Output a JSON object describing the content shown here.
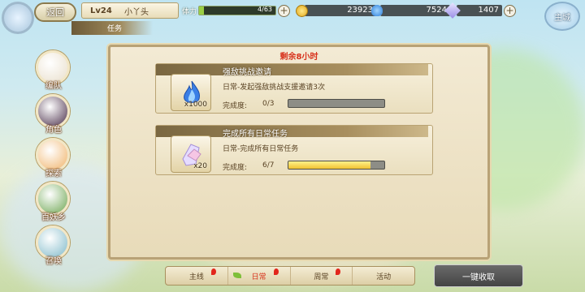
{
  "header": {
    "back_label": "返回",
    "level": "Lv24",
    "player_name": "小丫头",
    "task_tab": "任务",
    "stamina_label": "体力",
    "stamina_value": "4/63",
    "stamina_fraction": 0.06,
    "gold": "23923",
    "gems": "7524",
    "crystals": "1407",
    "main_label": "主城"
  },
  "sidebar": [
    {
      "label": "编队",
      "color": "#e9dfcc",
      "icon": "squad-icon"
    },
    {
      "label": "角色",
      "color": "#4a2f4a",
      "icon": "character-icon"
    },
    {
      "label": "探索",
      "color": "#f0b36a",
      "icon": "explore-icon"
    },
    {
      "label": "百妖乡",
      "color": "#6da652",
      "icon": "village-icon"
    },
    {
      "label": "召唤",
      "color": "#7fb9c9",
      "icon": "summon-icon"
    }
  ],
  "panel": {
    "remaining": "剩余8小时",
    "quests": [
      {
        "title": "强敌挑战邀请",
        "description": "日常-发起强敌挑战支援邀请3次",
        "progress_label": "完成度:",
        "progress_text": "0/3",
        "progress": 0,
        "reward_count": "x1000",
        "reward_icon": "blue-flame-icon"
      },
      {
        "title": "完成所有日常任务",
        "description": "日常-完成所有日常任务",
        "progress_label": "完成度:",
        "progress_text": "6/7",
        "progress": 0.857,
        "reward_count": "x20",
        "reward_icon": "crystal-shard-icon"
      }
    ]
  },
  "tabs": [
    {
      "label": "主线",
      "alert": true
    },
    {
      "label": "日常",
      "alert": true,
      "active": true
    },
    {
      "label": "周常",
      "alert": true
    },
    {
      "label": "活动",
      "alert": false
    }
  ],
  "claim_all": "一键收取"
}
